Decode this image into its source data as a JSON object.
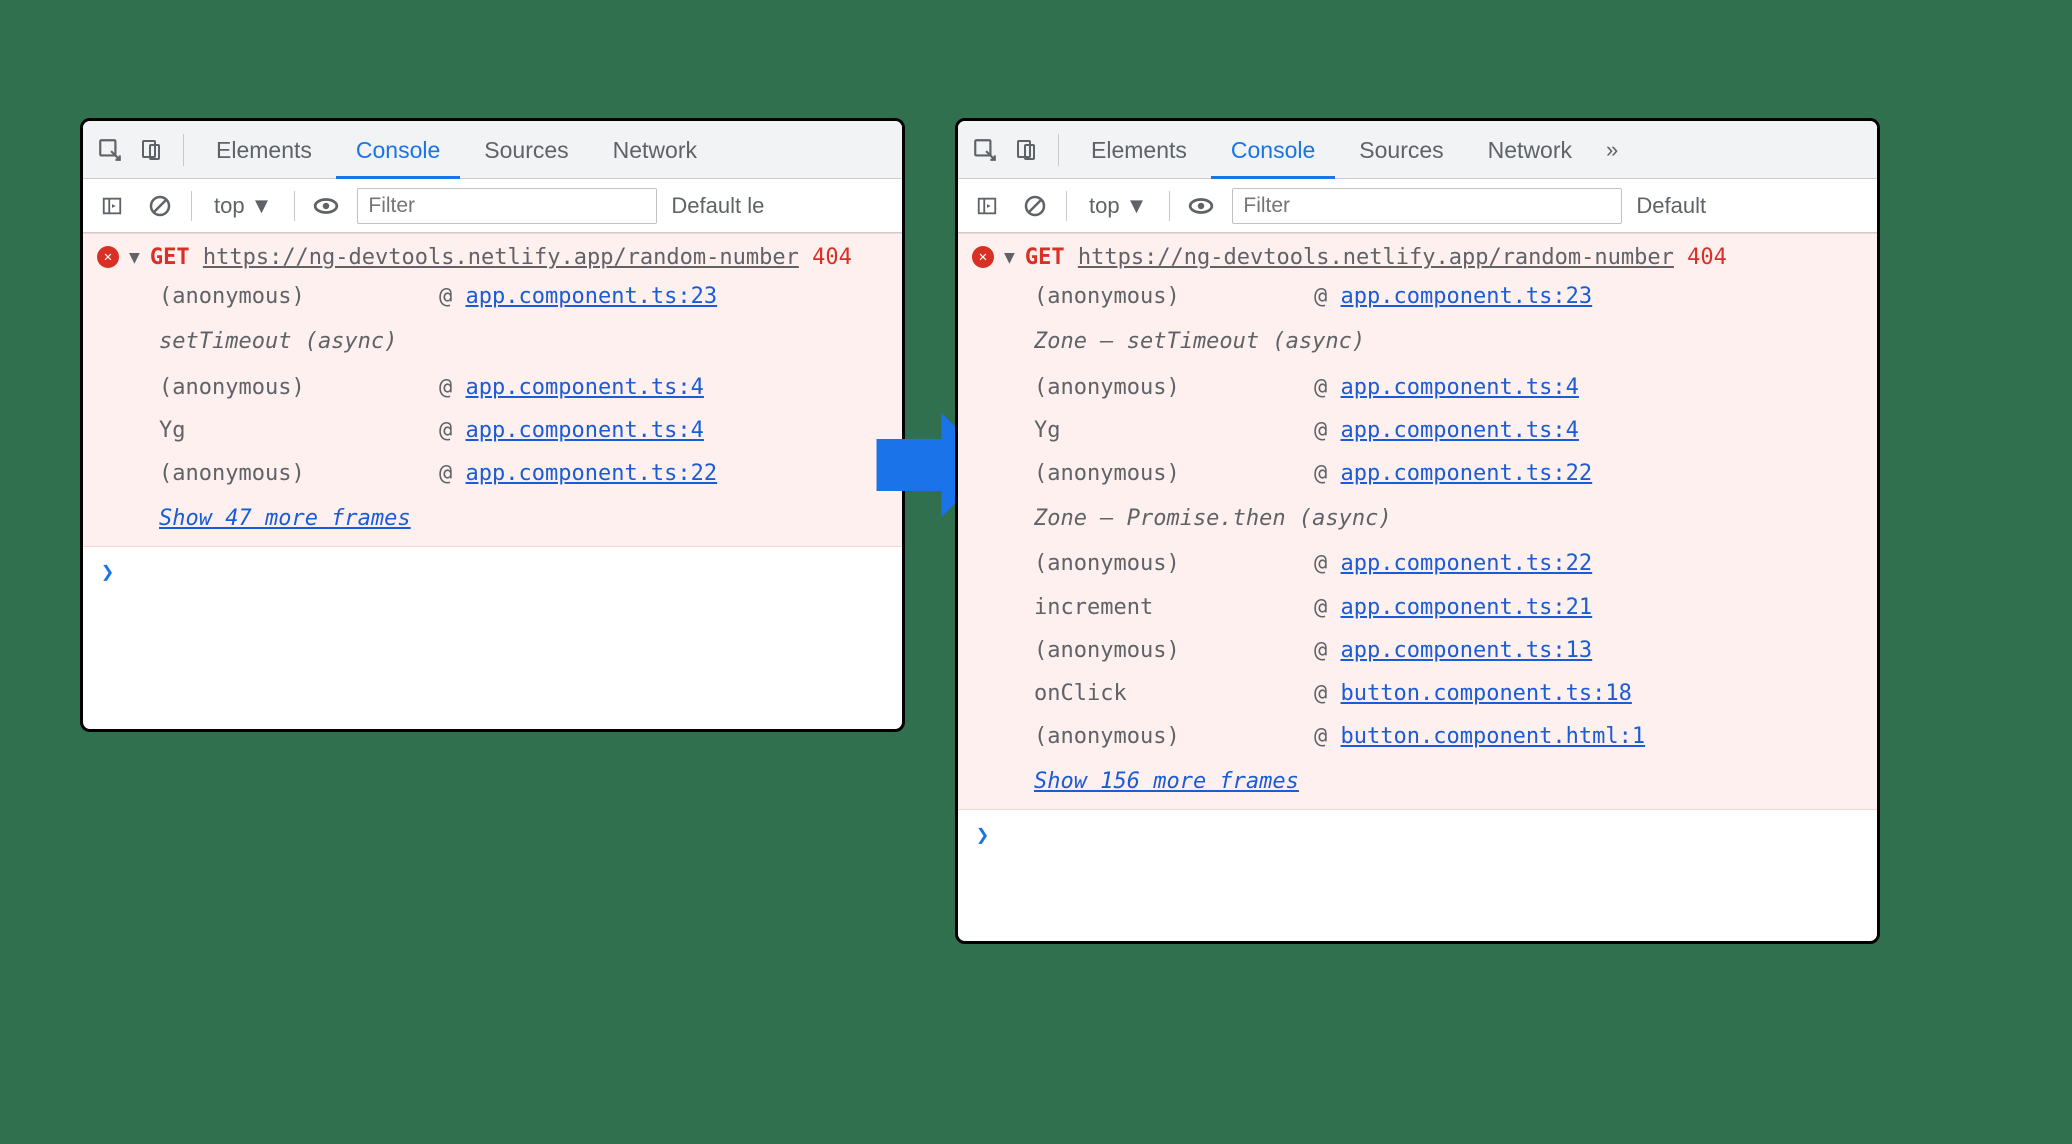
{
  "tabs": {
    "elements": "Elements",
    "console": "Console",
    "sources": "Sources",
    "network": "Network"
  },
  "toolbar": {
    "context": "top",
    "filter_placeholder": "Filter"
  },
  "left": {
    "level_truncated": "Default le",
    "error": {
      "method": "GET",
      "url": "https://ng-devtools.netlify.app/random-number",
      "status": "404"
    },
    "stack": [
      {
        "type": "frame",
        "fn": "(anonymous)",
        "src": "app.component.ts:23"
      },
      {
        "type": "async",
        "label": "setTimeout (async)"
      },
      {
        "type": "frame",
        "fn": "(anonymous)",
        "src": "app.component.ts:4"
      },
      {
        "type": "frame",
        "fn": "Yg",
        "src": "app.component.ts:4"
      },
      {
        "type": "frame",
        "fn": "(anonymous)",
        "src": "app.component.ts:22"
      }
    ],
    "show_more": "Show 47 more frames"
  },
  "right": {
    "level_truncated": "Default",
    "error": {
      "method": "GET",
      "url": "https://ng-devtools.netlify.app/random-number",
      "status": "404"
    },
    "stack": [
      {
        "type": "frame",
        "fn": "(anonymous)",
        "src": "app.component.ts:23"
      },
      {
        "type": "async",
        "label": "Zone – setTimeout (async)"
      },
      {
        "type": "frame",
        "fn": "(anonymous)",
        "src": "app.component.ts:4"
      },
      {
        "type": "frame",
        "fn": "Yg",
        "src": "app.component.ts:4"
      },
      {
        "type": "frame",
        "fn": "(anonymous)",
        "src": "app.component.ts:22"
      },
      {
        "type": "async",
        "label": "Zone – Promise.then (async)"
      },
      {
        "type": "frame",
        "fn": "(anonymous)",
        "src": "app.component.ts:22"
      },
      {
        "type": "frame",
        "fn": "increment",
        "src": "app.component.ts:21"
      },
      {
        "type": "frame",
        "fn": "(anonymous)",
        "src": "app.component.ts:13"
      },
      {
        "type": "frame",
        "fn": "onClick",
        "src": "button.component.ts:18"
      },
      {
        "type": "frame",
        "fn": "(anonymous)",
        "src": "button.component.html:1"
      }
    ],
    "show_more": "Show 156 more frames"
  }
}
